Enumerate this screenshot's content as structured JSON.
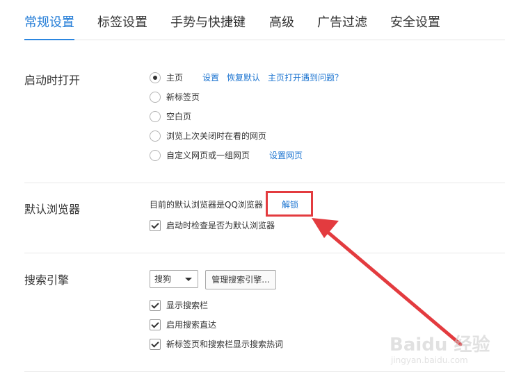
{
  "tabs": [
    {
      "label": "常规设置",
      "active": true
    },
    {
      "label": "标签设置",
      "active": false
    },
    {
      "label": "手势与快捷键",
      "active": false
    },
    {
      "label": "高级",
      "active": false
    },
    {
      "label": "广告过滤",
      "active": false
    },
    {
      "label": "安全设置",
      "active": false
    }
  ],
  "startup": {
    "title": "启动时打开",
    "options": [
      {
        "label": "主页",
        "checked": true
      },
      {
        "label": "新标签页",
        "checked": false
      },
      {
        "label": "空白页",
        "checked": false
      },
      {
        "label": "浏览上次关闭时在看的网页",
        "checked": false
      },
      {
        "label": "自定义网页或一组网页",
        "checked": false
      }
    ],
    "home_links": {
      "settings": "设置",
      "restore_default": "恢复默认",
      "home_problem": "主页打开遇到问题？"
    },
    "custom_link": "设置网页"
  },
  "default_browser": {
    "title": "默认浏览器",
    "status_text": "目前的默认浏览器是QQ浏览器",
    "unlock_link": "解锁",
    "check_on_start": {
      "label": "启动时检查是否为默认浏览器",
      "checked": true
    }
  },
  "search_engine": {
    "title": "搜索引擎",
    "selected": "搜狗",
    "manage_button": "管理搜索引擎...",
    "options": [
      {
        "label": "显示搜索栏",
        "checked": true
      },
      {
        "label": "启用搜索直达",
        "checked": true
      },
      {
        "label": "新标签页和搜索栏显示搜索热词",
        "checked": true
      }
    ]
  },
  "annotation": {
    "color": "#e33b3f"
  },
  "watermark": {
    "brand": "Baidu 经验",
    "url": "jingyan.baidu.com"
  },
  "colors": {
    "accent": "#1f7ad6",
    "link": "#1a73d0",
    "text": "#333333"
  }
}
